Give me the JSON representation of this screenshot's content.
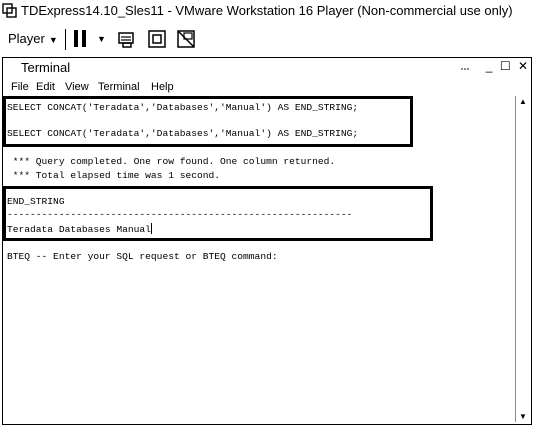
{
  "window": {
    "title": "TDExpress14.10_Sles11 - VMware Workstation 16 Player (Non-commercial use only)"
  },
  "toolbar": {
    "player_label": "Player"
  },
  "terminal": {
    "title": "Terminal",
    "menu": [
      "File",
      "Edit",
      "View",
      "Terminal",
      "Help"
    ],
    "lines": {
      "query1": "SELECT CONCAT('Teradata','Databases','Manual') AS END_STRING;",
      "query2": "SELECT CONCAT('Teradata','Databases','Manual') AS END_STRING;",
      "status1": " *** Query completed. One row found. One column returned.",
      "status2": " *** Total elapsed time was 1 second.",
      "column_header": "END_STRING",
      "separator": "------------------------------------------------------------",
      "result": "Teradata Databases Manual",
      "prompt": "BTEQ -- Enter your SQL request or BTEQ command:"
    }
  }
}
